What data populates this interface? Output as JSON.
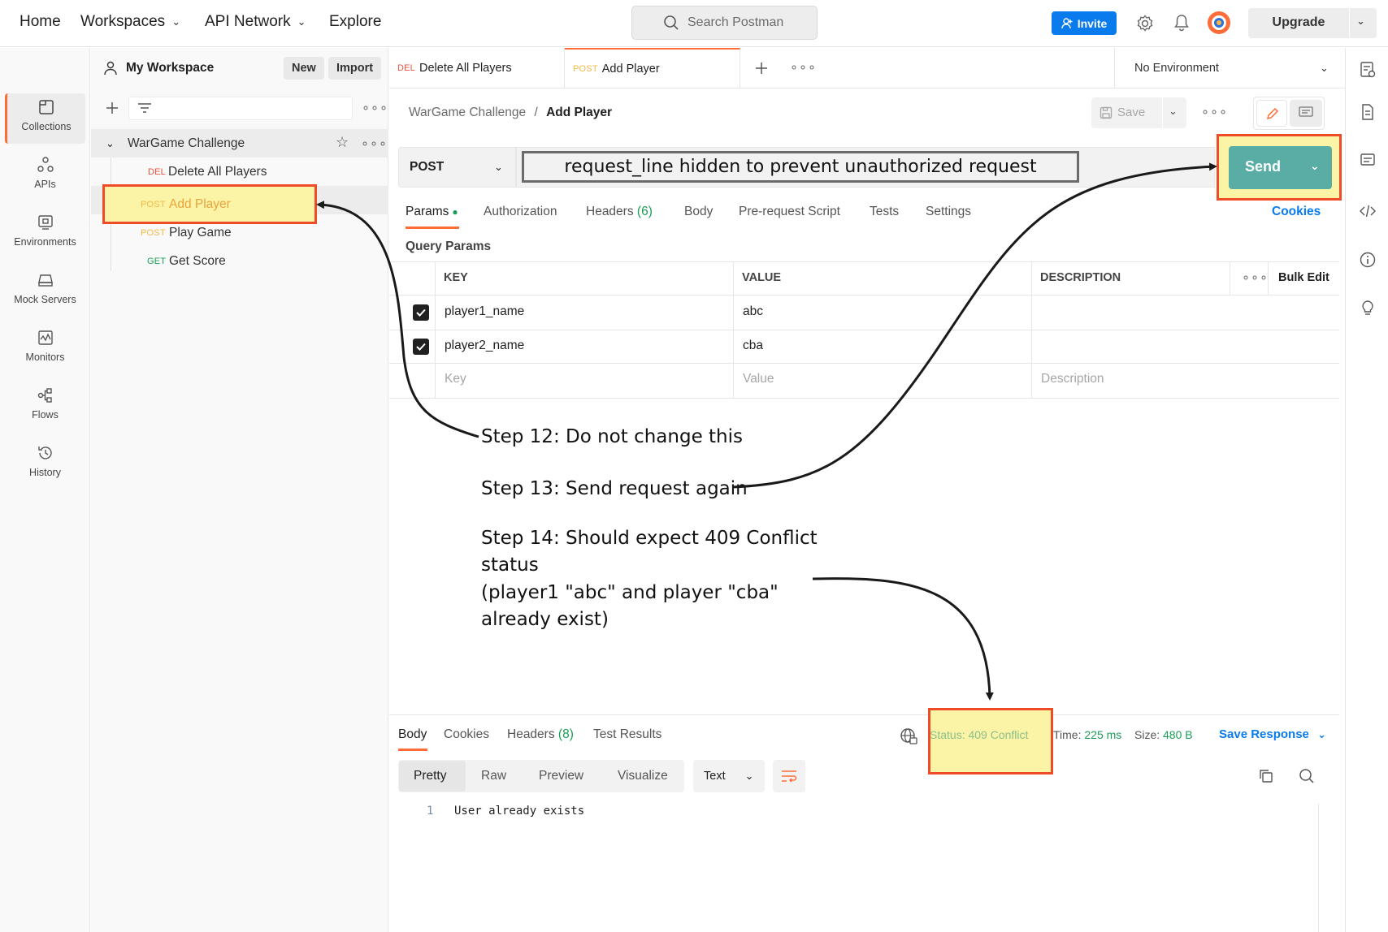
{
  "topnav": {
    "home": "Home",
    "workspaces": "Workspaces",
    "api_network": "API Network",
    "explore": "Explore",
    "search_placeholder": "Search Postman",
    "invite": "Invite",
    "upgrade": "Upgrade"
  },
  "rail": [
    {
      "label": "Collections",
      "icon": "collections-icon"
    },
    {
      "label": "APIs",
      "icon": "apis-icon"
    },
    {
      "label": "Environments",
      "icon": "environments-icon"
    },
    {
      "label": "Mock Servers",
      "icon": "mock-servers-icon"
    },
    {
      "label": "Monitors",
      "icon": "monitors-icon"
    },
    {
      "label": "Flows",
      "icon": "flows-icon"
    },
    {
      "label": "History",
      "icon": "history-icon"
    }
  ],
  "sidebar": {
    "workspace": "My Workspace",
    "new": "New",
    "import": "Import",
    "collection": "WarGame Challenge",
    "requests": [
      {
        "method": "DEL",
        "name": "Delete All Players"
      },
      {
        "method": "POST",
        "name": "Add Player"
      },
      {
        "method": "POST",
        "name": "Play Game"
      },
      {
        "method": "GET",
        "name": "Get Score"
      }
    ]
  },
  "tabs": [
    {
      "method": "DEL",
      "name": "Delete All Players"
    },
    {
      "method": "POST",
      "name": "Add Player"
    }
  ],
  "environment": "No Environment",
  "request": {
    "breadcrumb_parent": "WarGame Challenge",
    "breadcrumb_sep": "/",
    "breadcrumb_current": "Add Player",
    "save": "Save",
    "method": "POST",
    "url_note": "request_line hidden to prevent unauthorized request",
    "send": "Send",
    "tabs": {
      "params": "Params",
      "authorization": "Authorization",
      "headers": "Headers",
      "headers_count": "(6)",
      "body": "Body",
      "prerequest": "Pre-request Script",
      "tests": "Tests",
      "settings": "Settings"
    },
    "cookies": "Cookies",
    "query_params_title": "Query Params",
    "table": {
      "key_header": "KEY",
      "value_header": "VALUE",
      "description_header": "DESCRIPTION",
      "bulk_edit": "Bulk Edit",
      "rows": [
        {
          "key": "player1_name",
          "value": "abc",
          "checked": true
        },
        {
          "key": "player2_name",
          "value": "cba",
          "checked": true
        }
      ],
      "placeholder_key": "Key",
      "placeholder_value": "Value",
      "placeholder_description": "Description"
    }
  },
  "annotations": {
    "step12": "Step 12: Do not change this",
    "step13": "Step 13: Send request again",
    "step14_l1": "Step 14: Should expect 409 Conflict",
    "step14_l2": "status",
    "step14_l3": "(player1 \"abc\" and player \"cba\"",
    "step14_l4": "already exist)"
  },
  "response": {
    "tabs": {
      "body": "Body",
      "cookies": "Cookies",
      "headers": "Headers",
      "headers_count": "(8)",
      "test_results": "Test Results"
    },
    "status": "Status: 409 Conflict",
    "time_label": "Time:",
    "time_value": "225 ms",
    "size_label": "Size:",
    "size_value": "480 B",
    "save_response": "Save Response",
    "formats": [
      "Pretty",
      "Raw",
      "Preview",
      "Visualize"
    ],
    "text_mode": "Text",
    "line_number": "1",
    "body_text": "User already exists"
  },
  "colors": {
    "accent": "#ff6c37",
    "invite_blue": "#097bed",
    "send_teal": "#5aada5",
    "highlight_yellow": "#fbf3a6",
    "highlight_red": "#ee4b28"
  }
}
